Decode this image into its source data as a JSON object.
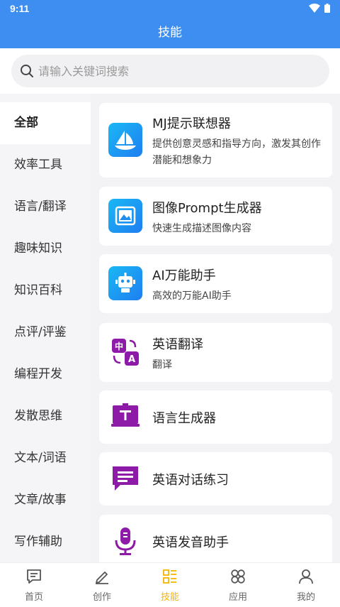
{
  "status": {
    "time": "9:11"
  },
  "header": {
    "title": "技能"
  },
  "search": {
    "placeholder": "请输入关键词搜索"
  },
  "sidebar": {
    "items": [
      {
        "label": "全部"
      },
      {
        "label": "效率工具"
      },
      {
        "label": "语言/翻译"
      },
      {
        "label": "趣味知识"
      },
      {
        "label": "知识百科"
      },
      {
        "label": "点评/评鉴"
      },
      {
        "label": "编程开发"
      },
      {
        "label": "发散思维"
      },
      {
        "label": "文本/词语"
      },
      {
        "label": "文章/故事"
      },
      {
        "label": "写作辅助"
      }
    ]
  },
  "skills": [
    {
      "title": "MJ提示联想器",
      "desc": "提供创意灵感和指导方向，激发其创作潜能和想象力",
      "icon": "sailboat-icon"
    },
    {
      "title": "图像Prompt生成器",
      "desc": "快速生成描述图像内容",
      "icon": "image-icon"
    },
    {
      "title": "AI万能助手",
      "desc": "高效的万能AI助手",
      "icon": "robot-icon"
    },
    {
      "title": "英语翻译",
      "desc": "翻译",
      "icon": "translate-icon"
    },
    {
      "title": "语言生成器",
      "desc": "",
      "icon": "text-screen-icon"
    },
    {
      "title": "英语对话练习",
      "desc": "",
      "icon": "chat-icon"
    },
    {
      "title": "英语发音助手",
      "desc": "",
      "icon": "microphone-icon"
    }
  ],
  "tabbar": {
    "items": [
      {
        "label": "首页"
      },
      {
        "label": "创作"
      },
      {
        "label": "技能"
      },
      {
        "label": "应用"
      },
      {
        "label": "我的"
      }
    ]
  },
  "colors": {
    "primary": "#3d8ef0",
    "accent": "#f5b400",
    "icon_purple": "#8e1aa8"
  }
}
